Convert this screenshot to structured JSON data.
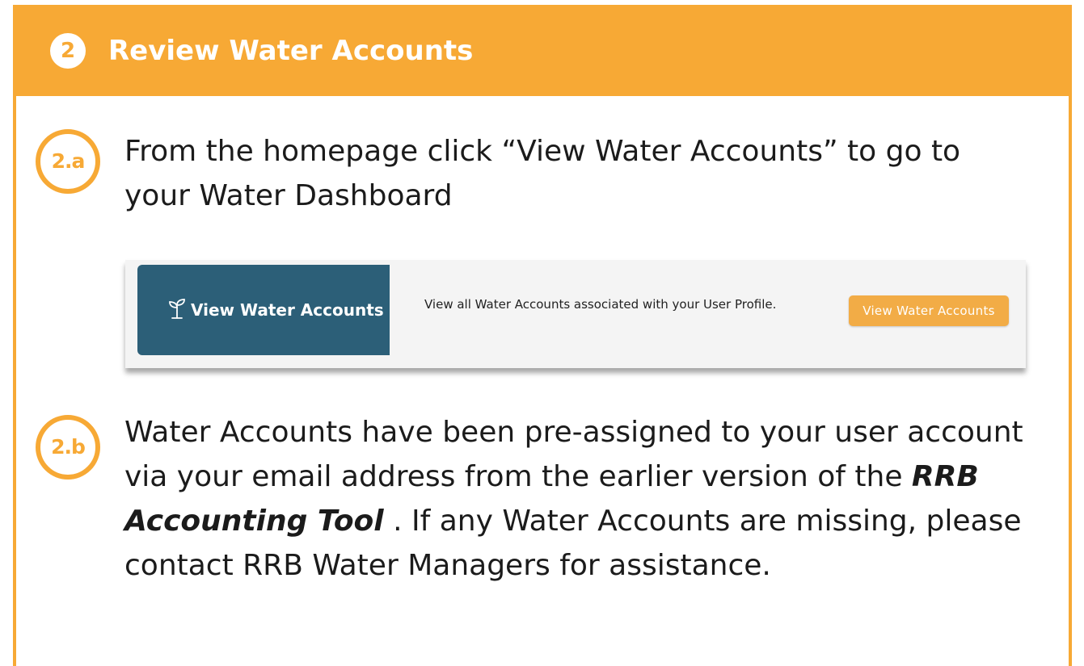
{
  "header": {
    "step_number": "2",
    "title": "Review Water Accounts"
  },
  "step_a": {
    "badge": "2.a",
    "text": "From the homepage click “View Water Accounts” to go to your Water Dashboard"
  },
  "card": {
    "icon": "seedling-icon",
    "title": "View Water Accounts",
    "description": "View all Water Accounts associated with your User Profile.",
    "button_label": "View Water Accounts"
  },
  "step_b": {
    "badge": "2.b",
    "text_before": "Water Accounts have been pre-assigned to your user account via your email address from the earlier version of the ",
    "emphasis": "RRB Accounting Tool",
    "text_after": " . If any Water Accounts are missing, please contact RRB Water Managers for assistance."
  },
  "colors": {
    "accent": "#F7A935",
    "card_dark": "#2C5F78",
    "button": "#F2AC46"
  }
}
